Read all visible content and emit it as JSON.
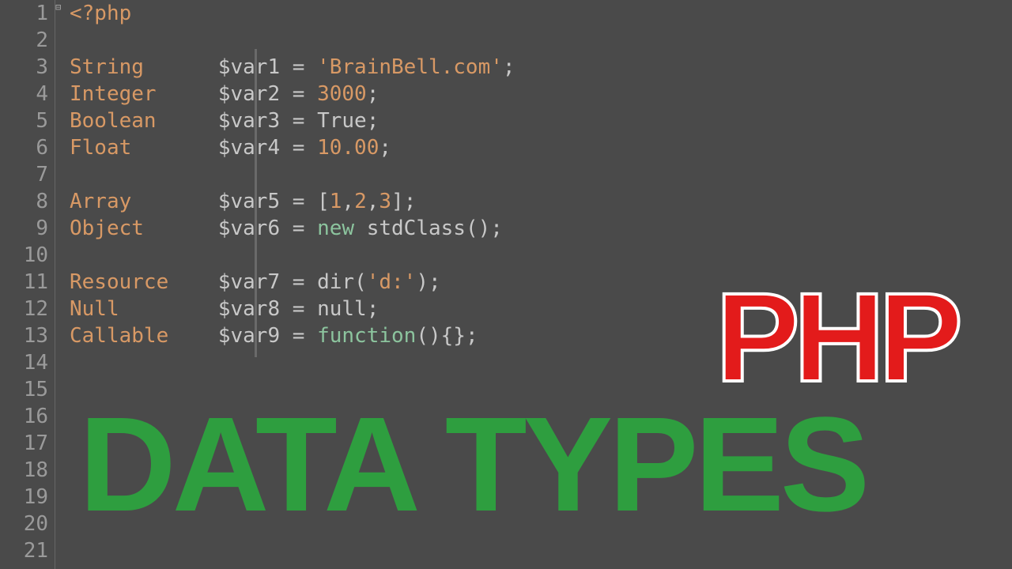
{
  "gutter": {
    "lines": [
      "1",
      "2",
      "3",
      "4",
      "5",
      "6",
      "7",
      "8",
      "9",
      "10",
      "11",
      "12",
      "13",
      "14",
      "15",
      "16",
      "17",
      "18",
      "19",
      "20",
      "21"
    ]
  },
  "fold_marker": "⊟",
  "code": {
    "open_tag": "<?php",
    "rows": [
      {
        "label": "String",
        "var": "$var1",
        "eq": " = ",
        "value": "'BrainBell.com'",
        "vclass": "string",
        "end": ";"
      },
      {
        "label": "Integer",
        "var": "$var2",
        "eq": " = ",
        "value": "3000",
        "vclass": "number",
        "end": ";"
      },
      {
        "label": "Boolean",
        "var": "$var3",
        "eq": " = ",
        "value": "True",
        "vclass": "bool-kw",
        "end": ";"
      },
      {
        "label": "Float",
        "var": "$var4",
        "eq": " = ",
        "value": "10.00",
        "vclass": "number",
        "end": ";"
      },
      {
        "blank": true
      },
      {
        "label": "Array",
        "var": "$var5",
        "eq": " = ",
        "value_html": "<span class='bracket'>[</span><span class='number'>1</span><span class='operator'>,</span><span class='number'>2</span><span class='operator'>,</span><span class='number'>3</span><span class='bracket'>]</span>",
        "end": ";"
      },
      {
        "label": "Object",
        "var": "$var6",
        "eq": " = ",
        "value_html": "<span class='keyword'>new</span> <span class='classname'>stdClass</span><span class='paren'>()</span>",
        "end": ";"
      },
      {
        "blank": true
      },
      {
        "label": "Resource",
        "var": "$var7",
        "eq": " = ",
        "value_html": "<span class='func'>dir</span><span class='paren'>(</span><span class='string'>'d:'</span><span class='paren'>)</span>",
        "end": ";"
      },
      {
        "label": "Null",
        "var": "$var8",
        "eq": " = ",
        "value": "null",
        "vclass": "null-kw",
        "end": ";"
      },
      {
        "label": "Callable",
        "var": "$var9",
        "eq": " = ",
        "value_html": "<span class='keyword'>function</span><span class='paren'>()</span><span class='bracket'>{}</span>",
        "end": ";"
      }
    ]
  },
  "overlay": {
    "php": "PHP",
    "datatypes": "DATA TYPES"
  }
}
